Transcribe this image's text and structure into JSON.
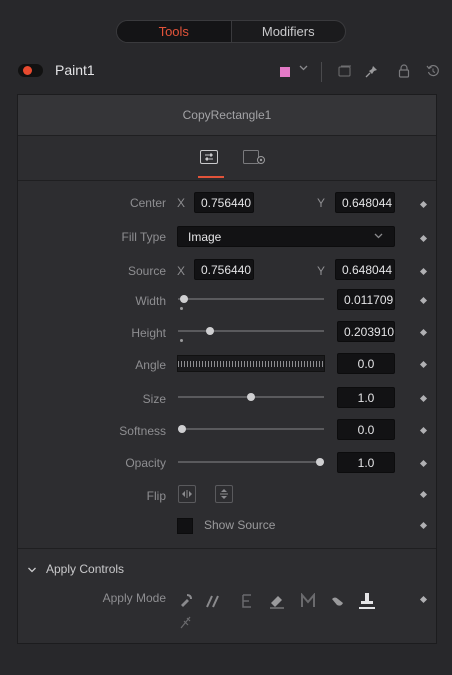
{
  "tabs": {
    "tools": "Tools",
    "modifiers": "Modifiers"
  },
  "node": {
    "name": "Paint1",
    "color": "#e37ac6"
  },
  "header_icons": [
    "copy-icon",
    "pin-icon",
    "lock-icon",
    "reset-icon"
  ],
  "subtitle": "CopyRectangle1",
  "subtabs": [
    "controls-tab-icon",
    "settings-tab-icon"
  ],
  "controls": {
    "center": {
      "label": "Center",
      "x_axis": "X",
      "x": "0.756440",
      "y_axis": "Y",
      "y": "0.648044"
    },
    "fill_type": {
      "label": "Fill Type",
      "value": "Image"
    },
    "source": {
      "label": "Source",
      "x_axis": "X",
      "x": "0.756440",
      "y_axis": "Y",
      "y": "0.648044"
    },
    "width": {
      "label": "Width",
      "value": "0.011709",
      "level": 0.0117
    },
    "height": {
      "label": "Height",
      "value": "0.203910",
      "level": 0.204
    },
    "angle": {
      "label": "Angle",
      "value": "0.0"
    },
    "size": {
      "label": "Size",
      "value": "1.0",
      "level": 0.5
    },
    "softness": {
      "label": "Softness",
      "value": "0.0",
      "level": 0.0
    },
    "opacity": {
      "label": "Opacity",
      "value": "1.0",
      "level": 1.0
    },
    "flip": {
      "label": "Flip"
    },
    "show_source": {
      "label": "Show Source",
      "checked": false
    }
  },
  "apply": {
    "section_label": "Apply Controls",
    "mode_label": "Apply Mode",
    "modes": [
      "color-mode-icon",
      "clone-mode-icon",
      "emboss-mode-icon",
      "erase-mode-icon",
      "merge-mode-icon",
      "smear-mode-icon",
      "stamp-mode-icon",
      "wire-mode-icon"
    ],
    "active_mode": "stamp-mode-icon"
  },
  "colors": {
    "accent": "#e2533a",
    "record_dot": "#e84a2f"
  }
}
